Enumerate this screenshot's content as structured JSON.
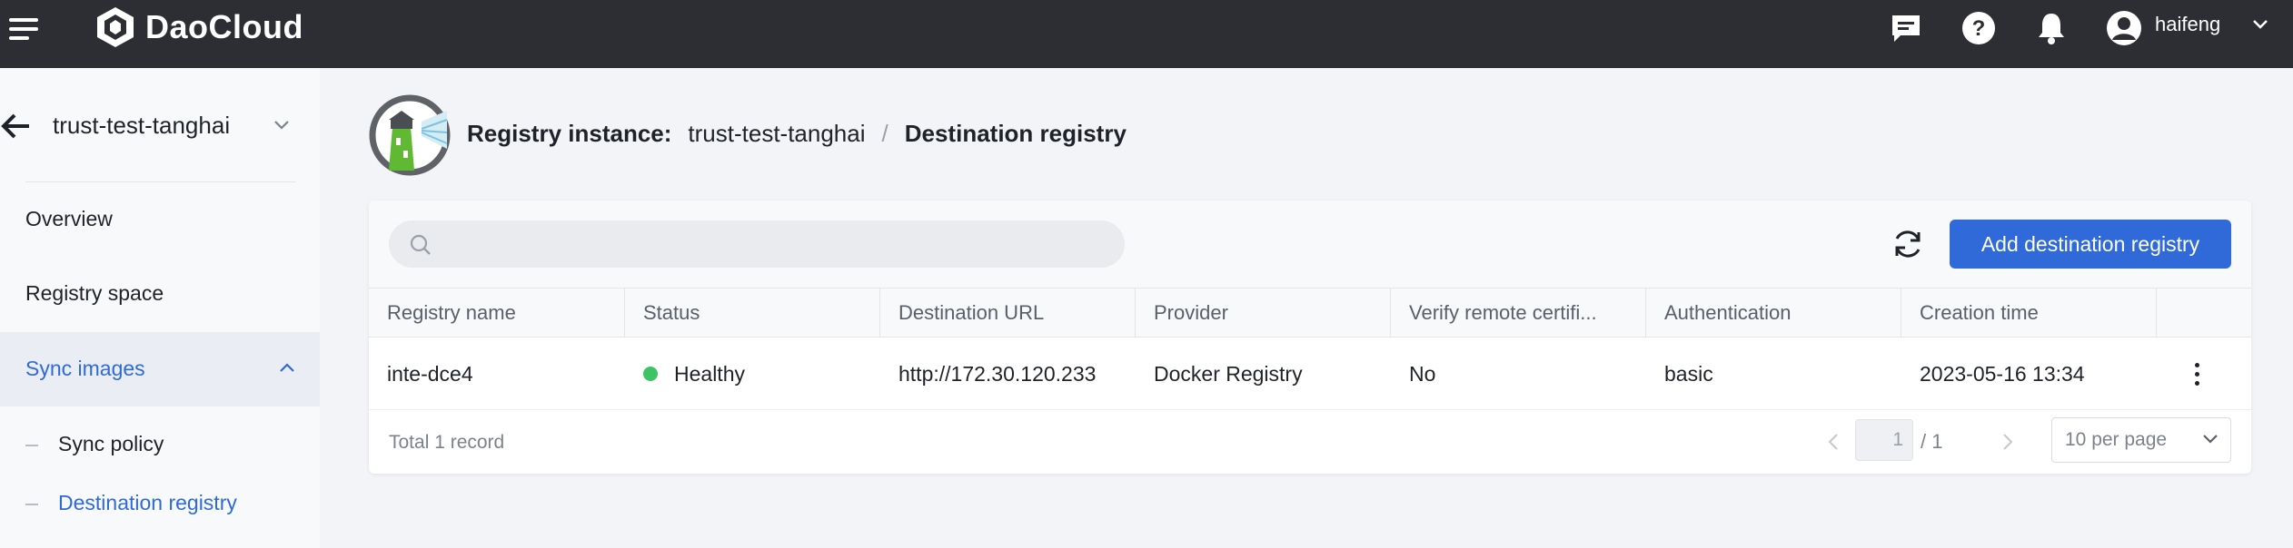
{
  "topbar": {
    "brand": "DaoCloud",
    "username": "haifeng",
    "icons": [
      "menu-icon",
      "message-icon",
      "help-icon",
      "bell-icon",
      "user-avatar-icon",
      "chevron-down-icon"
    ]
  },
  "sidebar": {
    "workspace_name": "trust-test-tanghai",
    "items": [
      {
        "label": "Overview"
      },
      {
        "label": "Registry space"
      },
      {
        "label": "Sync images"
      }
    ],
    "sub_items": [
      {
        "label": "Sync policy"
      },
      {
        "label": "Destination registry"
      }
    ]
  },
  "header": {
    "instance_label": "Registry instance:",
    "instance_name": "trust-test-tanghai",
    "separator": "/",
    "current_page": "Destination registry"
  },
  "toolbar": {
    "search_placeholder": "",
    "add_button_label": "Add destination registry"
  },
  "table": {
    "columns": [
      "Registry name",
      "Status",
      "Destination URL",
      "Provider",
      "Verify remote certifi...",
      "Authentication",
      "Creation time"
    ],
    "rows": [
      {
        "name": "inte-dce4",
        "status": "Healthy",
        "url": "http://172.30.120.233",
        "provider": "Docker Registry",
        "verify": "No",
        "auth": "basic",
        "created": "2023-05-16 13:34"
      }
    ]
  },
  "footer": {
    "total": "Total 1 record",
    "current_page": "1",
    "total_pages": "/ 1",
    "per_page": "10 per page"
  },
  "colors": {
    "topbar_bg": "#2c2e33",
    "accent": "#2f6ad8",
    "healthy": "#3cc364"
  }
}
